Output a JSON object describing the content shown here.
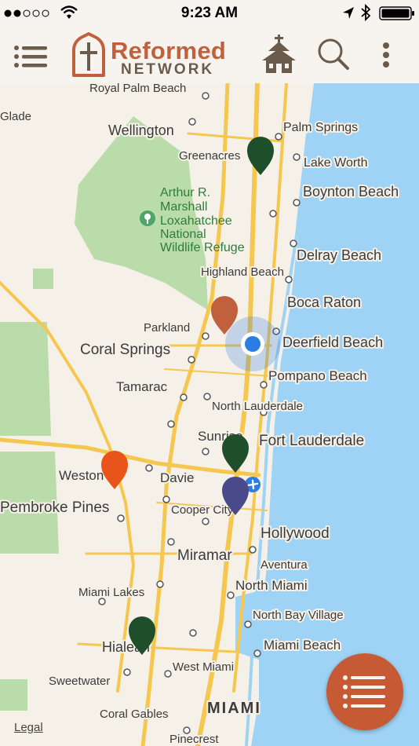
{
  "status_bar": {
    "time": "9:23 AM",
    "signal_dots": 5,
    "signal_filled": 2
  },
  "header": {
    "logo_top": "Reformed",
    "logo_bottom": "NETWORK",
    "icons": [
      "menu-icon",
      "church-icon",
      "search-icon",
      "more-vertical-icon"
    ],
    "colors": {
      "brand": "#c0603d",
      "brand_dark": "#6b5b4a"
    }
  },
  "map": {
    "labels": {
      "royal_palm": "Royal Palm Beach",
      "glade": "Glade",
      "wellington": "Wellington",
      "palm_springs": "Palm Springs",
      "greenacres": "Greenacres",
      "lake_worth": "Lake Worth",
      "boynton": "Boynton Beach",
      "refuge_1": "Arthur R.",
      "refuge_2": "Marshall",
      "refuge_3": "Loxahatchee",
      "refuge_4": "National",
      "refuge_5": "Wildlife Refuge",
      "delray": "Delray Beach",
      "highland": "Highland Beach",
      "boca": "Boca Raton",
      "parkland": "Parkland",
      "deerfield": "Deerfield Beach",
      "coral_springs": "Coral Springs",
      "pompano": "Pompano Beach",
      "tamarac": "Tamarac",
      "n_lauderdale": "North Lauderdale",
      "sunrise": "Sunrise",
      "fort_lauderdale": "Fort Lauderdale",
      "weston": "Weston",
      "davie": "Davie",
      "pembroke": "Pembroke Pines",
      "cooper": "Cooper City",
      "hollywood": "Hollywood",
      "miramar": "Miramar",
      "aventura": "Aventura",
      "miami_lakes": "Miami Lakes",
      "north_miami": "North Miami",
      "north_bay": "North Bay Village",
      "hialeah": "Hialeah",
      "miami_beach": "Miami Beach",
      "sweetwater": "Sweetwater",
      "west_miami": "West Miami",
      "miami": "MIAMI",
      "coral_gables": "Coral Gables",
      "pinecrest": "Pinecrest"
    },
    "pins": [
      {
        "name": "church-pin-dark-green",
        "color": "#1f4f2a"
      },
      {
        "name": "church-pin-rust",
        "color": "#c0603d"
      },
      {
        "name": "church-pin-orange",
        "color": "#e8541a"
      },
      {
        "name": "church-pin-green",
        "color": "#1f4f2a"
      },
      {
        "name": "church-pin-blue",
        "color": "#4a4a8a"
      },
      {
        "name": "church-pin-hialeah",
        "color": "#1f4f2a"
      }
    ],
    "colors": {
      "water": "#9fd3f5",
      "land": "#f5f1e8",
      "park": "#b9dcaa",
      "road": "#f6c74f",
      "user_location": "#2a7de1"
    },
    "legal": "Legal"
  },
  "fab": {
    "icon": "list-icon",
    "color": "#c55a35"
  }
}
